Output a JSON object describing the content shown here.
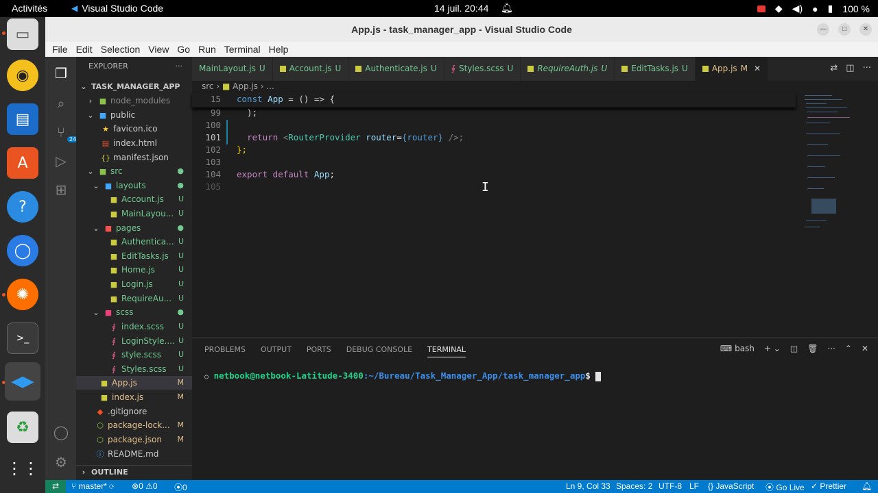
{
  "topbar": {
    "activities": "Activités",
    "app_name": "Visual Studio Code",
    "clock": "14 juil.  20:44",
    "battery": "100 %"
  },
  "window": {
    "title": "App.js - task_manager_app - Visual Studio Code",
    "menu": [
      "File",
      "Edit",
      "Selection",
      "View",
      "Go",
      "Run",
      "Terminal",
      "Help"
    ]
  },
  "activity": {
    "scm_badge": "24"
  },
  "explorer": {
    "header": "EXPLORER",
    "root": "TASK_MANAGER_APP",
    "outline": "OUTLINE",
    "items": [
      {
        "label": "node_modules",
        "status": ""
      },
      {
        "label": "public",
        "status": ""
      },
      {
        "label": "favicon.ico",
        "status": ""
      },
      {
        "label": "index.html",
        "status": ""
      },
      {
        "label": "manifest.json",
        "status": ""
      },
      {
        "label": "src",
        "status": ""
      },
      {
        "label": "layouts",
        "status": ""
      },
      {
        "label": "Account.js",
        "status": "U"
      },
      {
        "label": "MainLayou...",
        "status": "U"
      },
      {
        "label": "pages",
        "status": ""
      },
      {
        "label": "Authentica...",
        "status": "U"
      },
      {
        "label": "EditTasks.js",
        "status": "U"
      },
      {
        "label": "Home.js",
        "status": "U"
      },
      {
        "label": "Login.js",
        "status": "U"
      },
      {
        "label": "RequireAu...",
        "status": "U"
      },
      {
        "label": "scss",
        "status": ""
      },
      {
        "label": "index.scss",
        "status": "U"
      },
      {
        "label": "LoginStyle....",
        "status": "U"
      },
      {
        "label": "style.scss",
        "status": "U"
      },
      {
        "label": "Styles.scss",
        "status": "U"
      },
      {
        "label": "App.js",
        "status": "M"
      },
      {
        "label": "index.js",
        "status": "M"
      },
      {
        "label": ".gitignore",
        "status": ""
      },
      {
        "label": "package-lock...",
        "status": "M"
      },
      {
        "label": "package.json",
        "status": "M"
      },
      {
        "label": "README.md",
        "status": ""
      }
    ]
  },
  "tabs": [
    {
      "label": "MainLayout.js",
      "status": "U"
    },
    {
      "label": "Account.js",
      "status": "U"
    },
    {
      "label": "Authenticate.js",
      "status": "U"
    },
    {
      "label": "Styles.scss",
      "status": "U"
    },
    {
      "label": "RequireAuth.js",
      "status": "U"
    },
    {
      "label": "EditTasks.js",
      "status": "U"
    },
    {
      "label": "App.js",
      "status": "M"
    }
  ],
  "breadcrumb": {
    "folder": "src",
    "file": "App.js",
    "more": "..."
  },
  "code": {
    "sticky_ln": "15",
    "sticky_kw": "const",
    "sticky_name": "App",
    "sticky_rest": " = () => {",
    "l99": "99",
    "l99_text": "  );",
    "l100": "100",
    "l101": "101",
    "l101_kw": "return",
    "l101_tag": "RouterProvider",
    "l101_attr": "router",
    "l101_val": "{router}",
    "l101_end": " />;",
    "l102": "102",
    "l102_text": "};",
    "l103": "103",
    "l104": "104",
    "l104_kw": "export default",
    "l104_name": "App",
    "l105": "105"
  },
  "panel": {
    "tabs": [
      "PROBLEMS",
      "OUTPUT",
      "PORTS",
      "DEBUG CONSOLE",
      "TERMINAL"
    ],
    "shell": "bash",
    "prompt_user": "netbook@netbook-Latitude-3400",
    "prompt_path": ":~/Bureau/Task_Manager_App/task_manager_app",
    "prompt_sym": "$"
  },
  "status": {
    "branch": "master*",
    "problems": "0",
    "warnings": "0",
    "ports": "0",
    "position": "Ln 9, Col 33",
    "spaces": "Spaces: 2",
    "encoding": "UTF-8",
    "eol": "LF",
    "language": "JavaScript",
    "golive": "Go Live",
    "prettier": "Prettier"
  }
}
